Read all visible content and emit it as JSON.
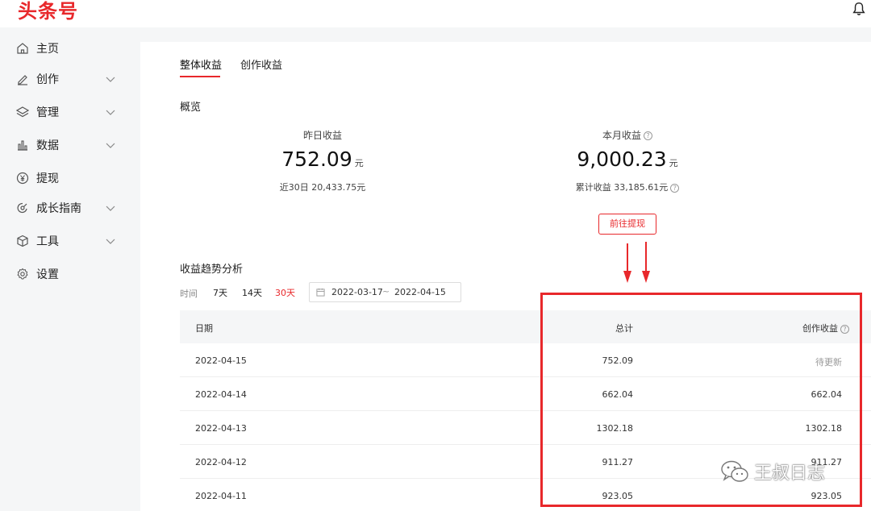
{
  "brand": {
    "logo_text": "头条号"
  },
  "header": {
    "notifications_icon": "bell-icon"
  },
  "sidebar": {
    "items": [
      {
        "label": "主页",
        "icon": "home-icon",
        "expandable": false
      },
      {
        "label": "创作",
        "icon": "pen-icon",
        "expandable": true
      },
      {
        "label": "管理",
        "icon": "layers-icon",
        "expandable": true
      },
      {
        "label": "数据",
        "icon": "bar-chart-icon",
        "expandable": true
      },
      {
        "label": "提现",
        "icon": "yen-coin-icon",
        "expandable": false
      },
      {
        "label": "成长指南",
        "icon": "compass-icon",
        "expandable": true
      },
      {
        "label": "工具",
        "icon": "cube-icon",
        "expandable": true
      },
      {
        "label": "设置",
        "icon": "gear-icon",
        "expandable": false
      }
    ]
  },
  "tabs": [
    {
      "label": "整体收益",
      "active": true
    },
    {
      "label": "创作收益",
      "active": false
    }
  ],
  "overview": {
    "title": "概览",
    "yesterday": {
      "label": "昨日收益",
      "value": "752.09",
      "unit": "元",
      "sub": "近30日 20,433.75元"
    },
    "month": {
      "label": "本月收益",
      "value": "9,000.23",
      "unit": "元",
      "sub": "累计收益 33,185.61元"
    },
    "withdraw_button": "前往提现"
  },
  "trend": {
    "title": "收益趋势分析",
    "range_label": "时间",
    "range_options": [
      {
        "label": "7天",
        "active": false
      },
      {
        "label": "14天",
        "active": false
      },
      {
        "label": "30天",
        "active": true
      }
    ],
    "date_start": "2022-03-17",
    "date_separator": "~",
    "date_end": "2022-04-15"
  },
  "table": {
    "columns": [
      "日期",
      "总计",
      "创作收益"
    ],
    "rows": [
      {
        "date": "2022-04-15",
        "total": "752.09",
        "creation": "待更新"
      },
      {
        "date": "2022-04-14",
        "total": "662.04",
        "creation": "662.04"
      },
      {
        "date": "2022-04-13",
        "total": "1302.18",
        "creation": "1302.18"
      },
      {
        "date": "2022-04-12",
        "total": "911.27",
        "creation": "911.27"
      },
      {
        "date": "2022-04-11",
        "total": "923.05",
        "creation": "923.05"
      }
    ]
  },
  "watermark": {
    "text": "王叔日志",
    "icon": "wechat-icon"
  },
  "colors": {
    "accent": "#e8282b",
    "annotation": "#e8282b"
  }
}
